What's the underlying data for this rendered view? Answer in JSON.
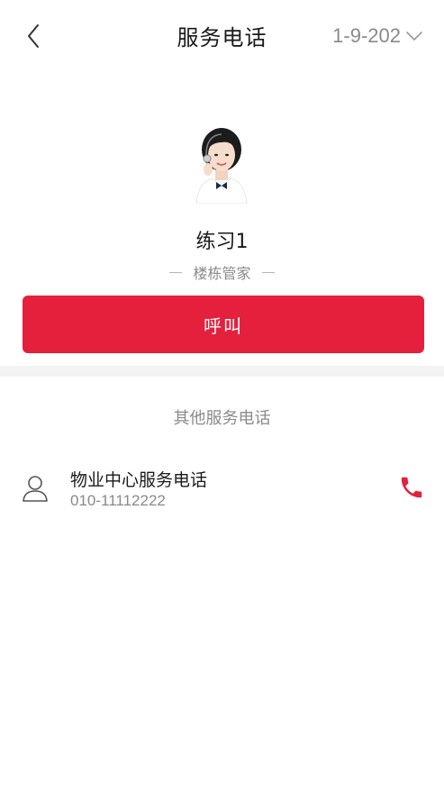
{
  "header": {
    "title": "服务电话",
    "building": "1-9-202",
    "back_icon": "chevron-left-icon",
    "dropdown_icon": "chevron-down-icon"
  },
  "profile": {
    "name": "练习1",
    "role": "楼栋管家",
    "call_label": "呼叫"
  },
  "other_services": {
    "title": "其他服务电话",
    "items": [
      {
        "name": "物业中心服务电话",
        "phone": "010-11112222",
        "icon": "user-icon",
        "action_icon": "phone-icon"
      }
    ]
  },
  "colors": {
    "accent": "#e4203d",
    "separator": "#f3f3f3",
    "muted_text": "#8a8a8a"
  }
}
